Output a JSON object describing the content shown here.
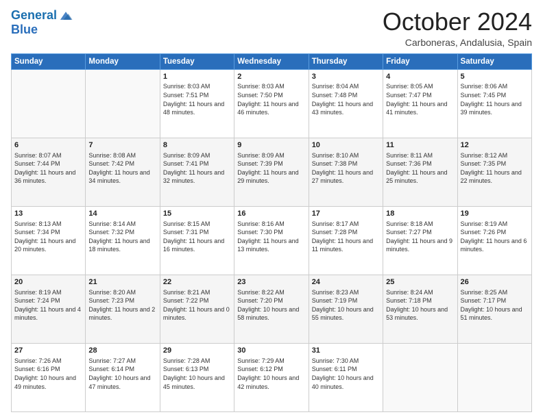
{
  "header": {
    "logo_line1": "General",
    "logo_line2": "Blue",
    "month": "October 2024",
    "location": "Carboneras, Andalusia, Spain"
  },
  "days_of_week": [
    "Sunday",
    "Monday",
    "Tuesday",
    "Wednesday",
    "Thursday",
    "Friday",
    "Saturday"
  ],
  "weeks": [
    [
      {
        "day": "",
        "info": ""
      },
      {
        "day": "",
        "info": ""
      },
      {
        "day": "1",
        "info": "Sunrise: 8:03 AM\nSunset: 7:51 PM\nDaylight: 11 hours and 48 minutes."
      },
      {
        "day": "2",
        "info": "Sunrise: 8:03 AM\nSunset: 7:50 PM\nDaylight: 11 hours and 46 minutes."
      },
      {
        "day": "3",
        "info": "Sunrise: 8:04 AM\nSunset: 7:48 PM\nDaylight: 11 hours and 43 minutes."
      },
      {
        "day": "4",
        "info": "Sunrise: 8:05 AM\nSunset: 7:47 PM\nDaylight: 11 hours and 41 minutes."
      },
      {
        "day": "5",
        "info": "Sunrise: 8:06 AM\nSunset: 7:45 PM\nDaylight: 11 hours and 39 minutes."
      }
    ],
    [
      {
        "day": "6",
        "info": "Sunrise: 8:07 AM\nSunset: 7:44 PM\nDaylight: 11 hours and 36 minutes."
      },
      {
        "day": "7",
        "info": "Sunrise: 8:08 AM\nSunset: 7:42 PM\nDaylight: 11 hours and 34 minutes."
      },
      {
        "day": "8",
        "info": "Sunrise: 8:09 AM\nSunset: 7:41 PM\nDaylight: 11 hours and 32 minutes."
      },
      {
        "day": "9",
        "info": "Sunrise: 8:09 AM\nSunset: 7:39 PM\nDaylight: 11 hours and 29 minutes."
      },
      {
        "day": "10",
        "info": "Sunrise: 8:10 AM\nSunset: 7:38 PM\nDaylight: 11 hours and 27 minutes."
      },
      {
        "day": "11",
        "info": "Sunrise: 8:11 AM\nSunset: 7:36 PM\nDaylight: 11 hours and 25 minutes."
      },
      {
        "day": "12",
        "info": "Sunrise: 8:12 AM\nSunset: 7:35 PM\nDaylight: 11 hours and 22 minutes."
      }
    ],
    [
      {
        "day": "13",
        "info": "Sunrise: 8:13 AM\nSunset: 7:34 PM\nDaylight: 11 hours and 20 minutes."
      },
      {
        "day": "14",
        "info": "Sunrise: 8:14 AM\nSunset: 7:32 PM\nDaylight: 11 hours and 18 minutes."
      },
      {
        "day": "15",
        "info": "Sunrise: 8:15 AM\nSunset: 7:31 PM\nDaylight: 11 hours and 16 minutes."
      },
      {
        "day": "16",
        "info": "Sunrise: 8:16 AM\nSunset: 7:30 PM\nDaylight: 11 hours and 13 minutes."
      },
      {
        "day": "17",
        "info": "Sunrise: 8:17 AM\nSunset: 7:28 PM\nDaylight: 11 hours and 11 minutes."
      },
      {
        "day": "18",
        "info": "Sunrise: 8:18 AM\nSunset: 7:27 PM\nDaylight: 11 hours and 9 minutes."
      },
      {
        "day": "19",
        "info": "Sunrise: 8:19 AM\nSunset: 7:26 PM\nDaylight: 11 hours and 6 minutes."
      }
    ],
    [
      {
        "day": "20",
        "info": "Sunrise: 8:19 AM\nSunset: 7:24 PM\nDaylight: 11 hours and 4 minutes."
      },
      {
        "day": "21",
        "info": "Sunrise: 8:20 AM\nSunset: 7:23 PM\nDaylight: 11 hours and 2 minutes."
      },
      {
        "day": "22",
        "info": "Sunrise: 8:21 AM\nSunset: 7:22 PM\nDaylight: 11 hours and 0 minutes."
      },
      {
        "day": "23",
        "info": "Sunrise: 8:22 AM\nSunset: 7:20 PM\nDaylight: 10 hours and 58 minutes."
      },
      {
        "day": "24",
        "info": "Sunrise: 8:23 AM\nSunset: 7:19 PM\nDaylight: 10 hours and 55 minutes."
      },
      {
        "day": "25",
        "info": "Sunrise: 8:24 AM\nSunset: 7:18 PM\nDaylight: 10 hours and 53 minutes."
      },
      {
        "day": "26",
        "info": "Sunrise: 8:25 AM\nSunset: 7:17 PM\nDaylight: 10 hours and 51 minutes."
      }
    ],
    [
      {
        "day": "27",
        "info": "Sunrise: 7:26 AM\nSunset: 6:16 PM\nDaylight: 10 hours and 49 minutes."
      },
      {
        "day": "28",
        "info": "Sunrise: 7:27 AM\nSunset: 6:14 PM\nDaylight: 10 hours and 47 minutes."
      },
      {
        "day": "29",
        "info": "Sunrise: 7:28 AM\nSunset: 6:13 PM\nDaylight: 10 hours and 45 minutes."
      },
      {
        "day": "30",
        "info": "Sunrise: 7:29 AM\nSunset: 6:12 PM\nDaylight: 10 hours and 42 minutes."
      },
      {
        "day": "31",
        "info": "Sunrise: 7:30 AM\nSunset: 6:11 PM\nDaylight: 10 hours and 40 minutes."
      },
      {
        "day": "",
        "info": ""
      },
      {
        "day": "",
        "info": ""
      }
    ]
  ]
}
